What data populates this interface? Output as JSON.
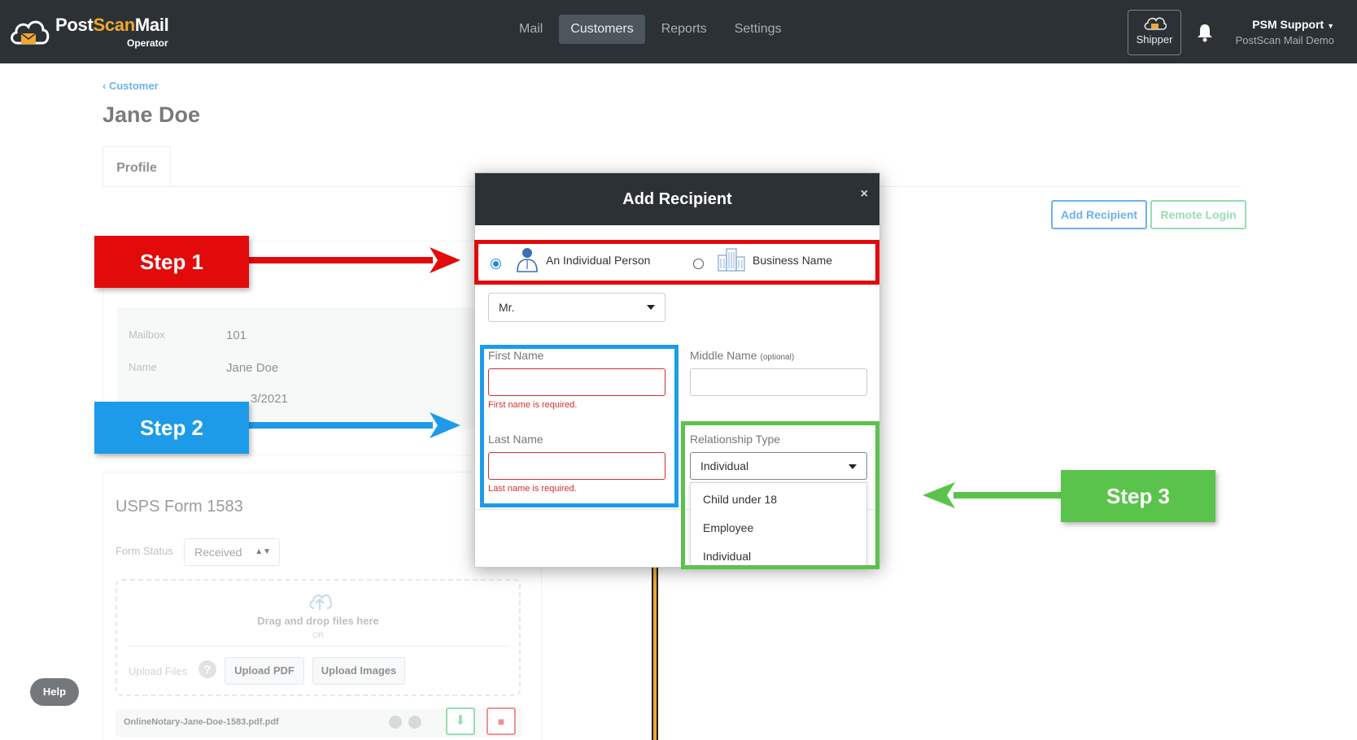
{
  "app": {
    "logo_text_a": "Post",
    "logo_text_b": "Scan",
    "logo_text_c": "Mail",
    "logo_sub": "Operator"
  },
  "nav": {
    "items": [
      {
        "label": "Mail",
        "active": false
      },
      {
        "label": "Customers",
        "active": true
      },
      {
        "label": "Reports",
        "active": false
      },
      {
        "label": "Settings",
        "active": false
      }
    ]
  },
  "header": {
    "shipper_label": "Shipper",
    "user_name": "PSM Support",
    "user_org": "PostScan Mail Demo"
  },
  "page": {
    "back_link": "Customer",
    "title": "Jane Doe",
    "tab": "Profile",
    "add_recipient_label": "Add Recipient",
    "remote_login_label": "Remote Login"
  },
  "info": {
    "rows": [
      {
        "label": "Mailbox",
        "value": "101"
      },
      {
        "label": "Name",
        "value": "Jane Doe"
      },
      {
        "label": "",
        "value": "3/2021"
      }
    ]
  },
  "usps": {
    "title": "USPS Form 1583",
    "form_status_label": "Form Status",
    "form_status_value": "Received",
    "dropzone_text": "Drag and drop files here",
    "dropzone_or": "OR",
    "upload_files_label": "Upload Files",
    "upload_pdf_label": "Upload PDF",
    "upload_images_label": "Upload Images",
    "file_name": "OnlineNotary-Jane-Doe-1583.pdf.pdf"
  },
  "help_label": "Help",
  "modal": {
    "title": "Add Recipient",
    "close": "×",
    "type_individual": "An Individual Person",
    "type_business": "Business Name",
    "prefix_value": "Mr.",
    "first_name_label": "First Name",
    "first_name_value": "",
    "first_name_error": "First name is required.",
    "middle_name_label": "Middle Name",
    "middle_name_optional": "(optional)",
    "middle_name_value": "",
    "last_name_label": "Last Name",
    "last_name_value": "",
    "last_name_error": "Last name is required.",
    "relationship_label": "Relationship Type",
    "relationship_value": "Individual",
    "relationship_options": [
      "Child under 18",
      "Employee",
      "Individual"
    ]
  },
  "annotations": {
    "step1": "Step 1",
    "step2": "Step 2",
    "step3": "Step 3",
    "colors": {
      "step1": "#e20a0a",
      "step2": "#1d9be8",
      "step3": "#5ac34b"
    }
  }
}
